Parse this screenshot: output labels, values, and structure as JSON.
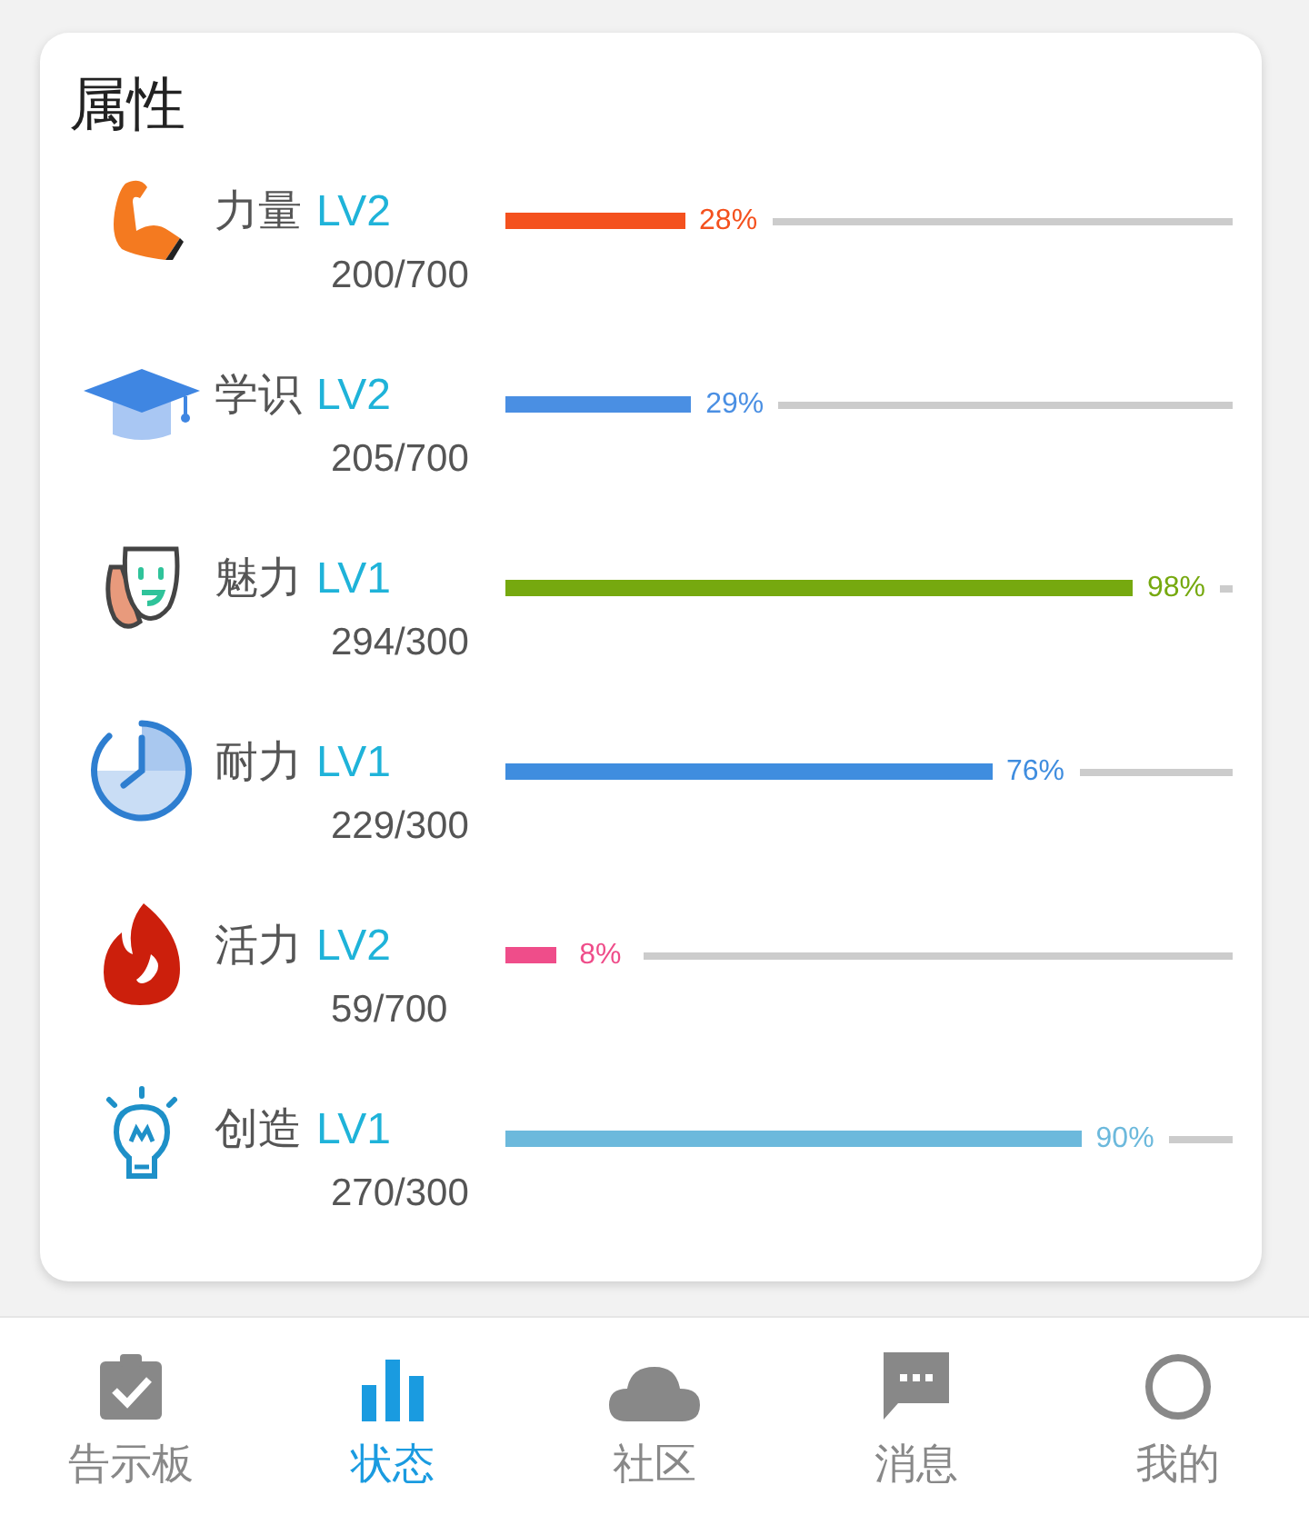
{
  "card": {
    "title": "属性"
  },
  "attributes": [
    {
      "name": "力量",
      "lv": "LV2",
      "progress": "200/700",
      "level": 0.28,
      "percent": "28%",
      "color": "#f4511e"
    },
    {
      "name": "学识",
      "lv": "LV2",
      "progress": "205/700",
      "level": 0.29,
      "percent": "29%",
      "color": "#4a8fe3"
    },
    {
      "name": "魅力",
      "lv": "LV1",
      "progress": "294/300",
      "level": 0.98,
      "percent": "98%",
      "color": "#76a90f"
    },
    {
      "name": "耐力",
      "lv": "LV1",
      "progress": "229/300",
      "level": 0.76,
      "percent": "76%",
      "color": "#3f8ddf"
    },
    {
      "name": "活力",
      "lv": "LV2",
      "progress": "59/700",
      "level": 0.08,
      "percent": "8%",
      "color": "#ef4d8a"
    },
    {
      "name": "创造",
      "lv": "LV1",
      "progress": "270/300",
      "level": 0.9,
      "percent": "90%",
      "color": "#6cb9dc"
    }
  ],
  "tabs": [
    {
      "label": "告示板",
      "selected": false
    },
    {
      "label": "状态",
      "selected": true
    },
    {
      "label": "社区",
      "selected": false
    },
    {
      "label": "消息",
      "selected": false
    },
    {
      "label": "我的",
      "selected": false
    }
  ]
}
